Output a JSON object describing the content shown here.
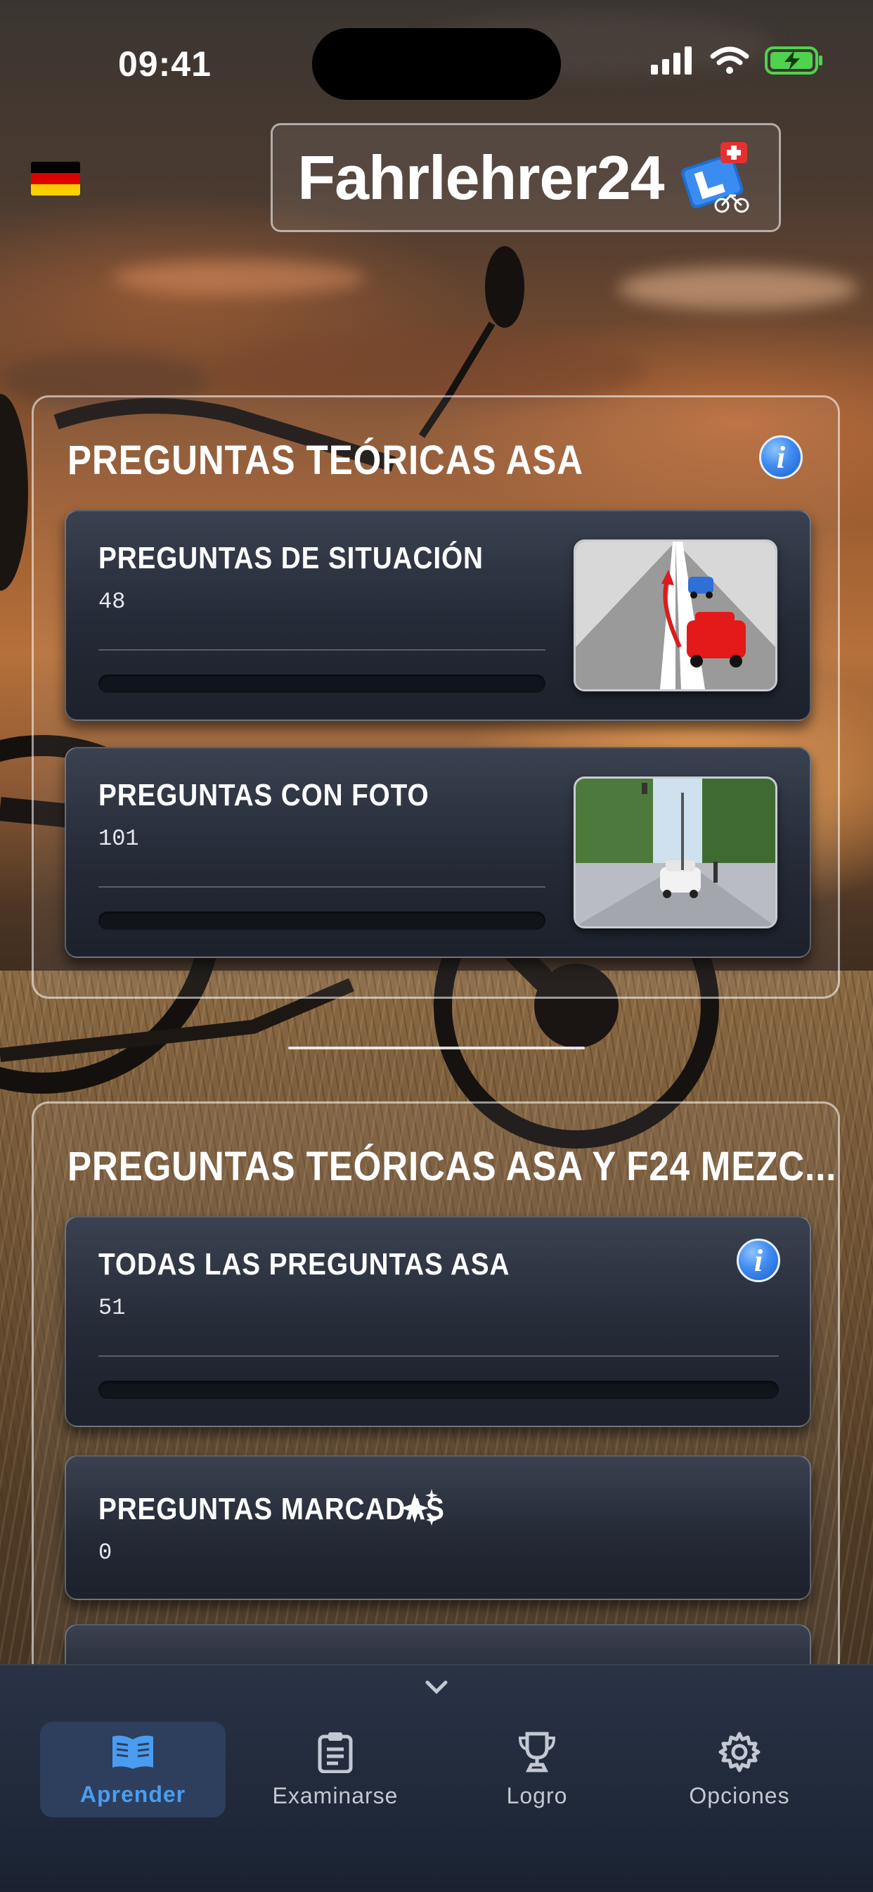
{
  "status_bar": {
    "time": "09:41"
  },
  "header": {
    "app_title": "Fahrlehrer24",
    "language_flag": "german-flag"
  },
  "section_asa": {
    "title": "PREGUNTAS TEÓRICAS ASA",
    "cards": [
      {
        "title": "PREGUNTAS DE SITUACIÓN",
        "count": "48"
      },
      {
        "title": "PREGUNTAS CON FOTO",
        "count": "101"
      }
    ]
  },
  "section_mixed": {
    "title": "PREGUNTAS TEÓRICAS ASA Y F24 MEZC...",
    "cards": [
      {
        "title": "TODAS LAS PREGUNTAS ASA",
        "count": "51"
      },
      {
        "title": "PREGUNTAS MARCADAS",
        "count": "0"
      }
    ]
  },
  "tabbar": {
    "tabs": [
      {
        "label": "Aprender",
        "icon": "book-icon",
        "active": true
      },
      {
        "label": "Examinarse",
        "icon": "clipboard-icon"
      },
      {
        "label": "Logro",
        "icon": "trophy-icon"
      },
      {
        "label": "Opciones",
        "icon": "gear-icon"
      }
    ]
  },
  "colors": {
    "accent": "#4a9cf0",
    "tabbar_bg": "#1f2838",
    "card_bg": "#242a36"
  }
}
